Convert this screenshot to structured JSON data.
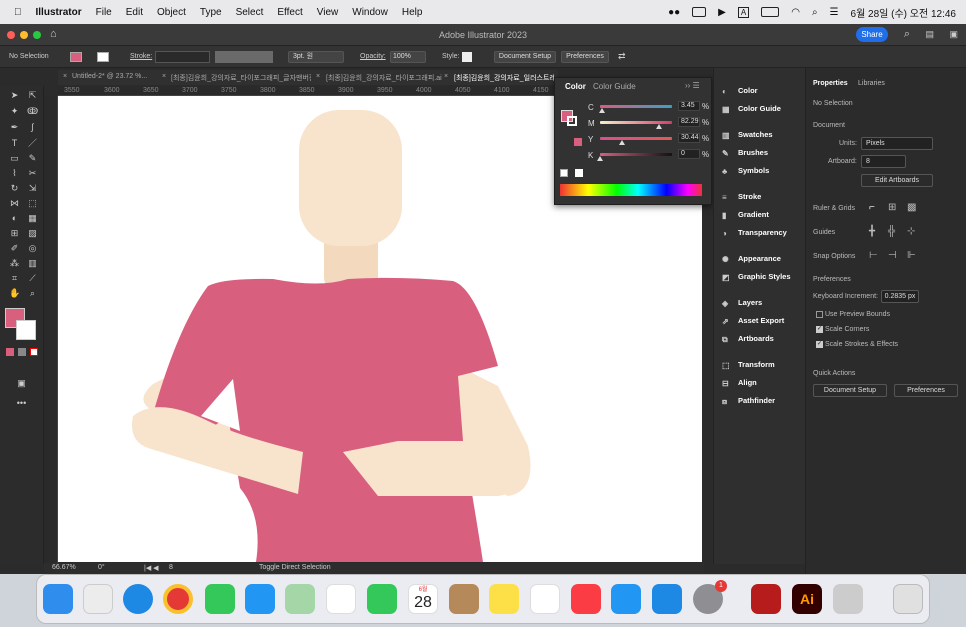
{
  "menubar": {
    "app": "Illustrator",
    "items": [
      "File",
      "Edit",
      "Object",
      "Type",
      "Select",
      "Effect",
      "View",
      "Window",
      "Help"
    ],
    "clock": "6월 28일 (수) 오전 12:46",
    "input_label": "A"
  },
  "window": {
    "title": "Adobe Illustrator 2023",
    "share_label": "Share"
  },
  "control": {
    "selection": "No Selection",
    "stroke_label": "Stroke:",
    "brush": "3pt. 원",
    "opacity_label": "Opacity:",
    "opacity_value": "100%",
    "style_label": "Style:",
    "doc_setup": "Document Setup",
    "preferences": "Preferences"
  },
  "tabs": [
    "Untitled-2* @ 23.72 %...",
    "[최종]김윤희_강의자료_타이포그래피_글자맨버전.ai*",
    "[최종]김윤희_강의자료_타이포그래피.ai*",
    "[최종]김윤희_강의자료_일러스트레이션"
  ],
  "ruler": [
    "3550",
    "3600",
    "3650",
    "3700",
    "3750",
    "3800",
    "3850",
    "3900",
    "3950",
    "4000",
    "4050",
    "4100",
    "4150"
  ],
  "vruler": [
    "2000",
    "2050",
    "2100",
    "2150",
    "2200",
    "2250",
    "2300",
    "2350",
    "2400",
    "2450",
    "2500",
    "2550"
  ],
  "status": {
    "zoom": "66.67%",
    "rotation": "0°",
    "artboard": "8",
    "tool_hint": "Toggle Direct Selection"
  },
  "color_panel": {
    "tab_color": "Color",
    "tab_guide": "Color Guide",
    "channels": [
      {
        "label": "C",
        "value": "3.45",
        "unit": "%",
        "fraction": 0.0345
      },
      {
        "label": "M",
        "value": "82.29",
        "unit": "%",
        "fraction": 0.8229
      },
      {
        "label": "Y",
        "value": "30.44",
        "unit": "%",
        "fraction": 0.3044
      },
      {
        "label": "K",
        "value": "0",
        "unit": "%",
        "fraction": 0
      }
    ],
    "fill_color": "#d95f7f"
  },
  "panels": [
    {
      "label": "Color",
      "icon": "color-icon"
    },
    {
      "label": "Color Guide",
      "icon": "color-guide-icon"
    },
    {
      "label": "Swatches",
      "icon": "swatches-icon"
    },
    {
      "label": "Brushes",
      "icon": "brushes-icon"
    },
    {
      "label": "Symbols",
      "icon": "symbols-icon"
    },
    {
      "label": "Stroke",
      "icon": "stroke-icon"
    },
    {
      "label": "Gradient",
      "icon": "gradient-icon"
    },
    {
      "label": "Transparency",
      "icon": "transparency-icon"
    },
    {
      "label": "Appearance",
      "icon": "appearance-icon"
    },
    {
      "label": "Graphic Styles",
      "icon": "graphic-styles-icon"
    },
    {
      "label": "Layers",
      "icon": "layers-icon"
    },
    {
      "label": "Asset Export",
      "icon": "asset-export-icon"
    },
    {
      "label": "Artboards",
      "icon": "artboards-icon"
    },
    {
      "label": "Transform",
      "icon": "transform-icon"
    },
    {
      "label": "Align",
      "icon": "align-icon"
    },
    {
      "label": "Pathfinder",
      "icon": "pathfinder-icon"
    }
  ],
  "properties": {
    "tab_properties": "Properties",
    "tab_libraries": "Libraries",
    "selection": "No Selection",
    "document_heading": "Document",
    "units_label": "Units:",
    "units_value": "Pixels",
    "artboard_label": "Artboard:",
    "artboard_value": "8",
    "edit_artboards": "Edit Artboards",
    "ruler_grids": "Ruler & Grids",
    "guides": "Guides",
    "snap_options": "Snap Options",
    "preferences_heading": "Preferences",
    "keyboard_increment_label": "Keyboard Increment:",
    "keyboard_increment_value": "0.2835 px",
    "use_preview_bounds": "Use Preview Bounds",
    "scale_corners": "Scale Corners",
    "scale_strokes": "Scale Strokes & Effects",
    "quick_actions": "Quick Actions",
    "doc_setup_btn": "Document Setup",
    "preferences_btn": "Preferences"
  },
  "dock": {
    "calendar_month": "6월",
    "calendar_day": "28",
    "badge": "1",
    "ai_label": "Ai"
  },
  "colors": {
    "shirt": "#d95f7f",
    "skin": "#f8e4cc",
    "neck": "#f3d9bd",
    "accent": "#1f6feb"
  }
}
